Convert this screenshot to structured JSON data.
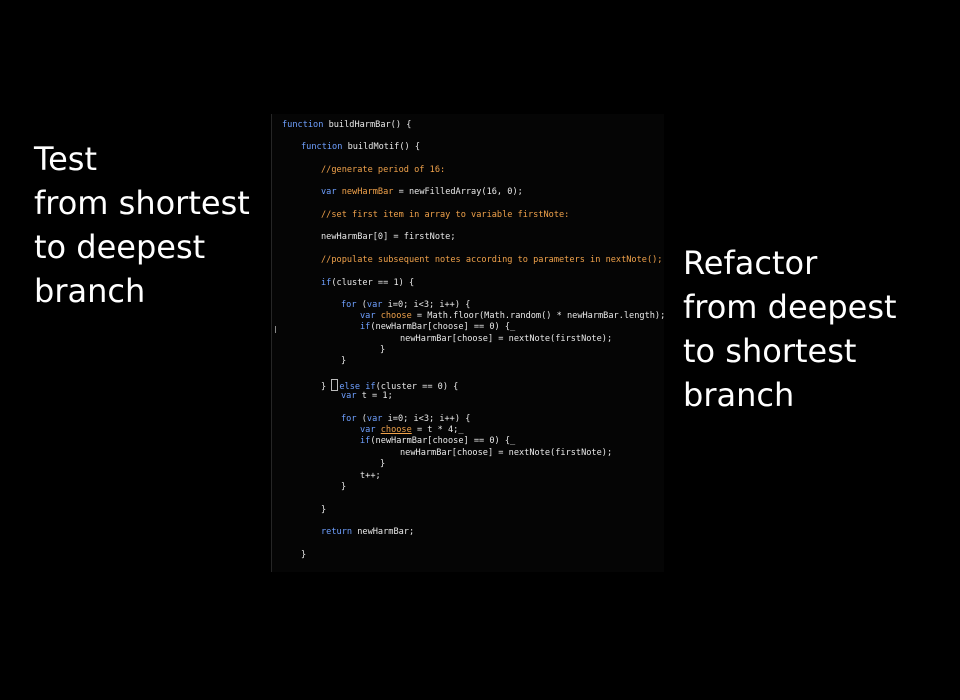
{
  "captions": {
    "left": [
      "Test",
      "from shortest",
      "to deepest",
      "branch"
    ],
    "right": [
      "Refactor",
      "from deepest",
      "to shortest",
      "branch"
    ]
  },
  "code": {
    "l1": {
      "kw": "function",
      "rest": " buildHarmBar() {"
    },
    "l2": {
      "kw": "function",
      "rest": " buildMotif() {"
    },
    "l3": "//generate period of 16:",
    "l4": {
      "kw": "var",
      "name": " newHarmBar",
      "rest": " = newFilledArray(16, 0);"
    },
    "l5": "//set first item in array to variable firstNote:",
    "l6": "newHarmBar[0] = firstNote;",
    "l7": "//populate subsequent notes according to parameters in nextNote();",
    "l8": {
      "kw": "if",
      "rest": "(cluster == 1) {"
    },
    "l9": {
      "kw": "for",
      "mid": " (",
      "kw2": "var",
      "rest": " i=0; i<3; i++) {"
    },
    "l10": {
      "kw": "var",
      "name": " choose",
      "rest": " = Math.floor(Math.random() * newHarmBar.length);"
    },
    "l11": {
      "kw": "if",
      "rest": "(newHarmBar[choose] == 0) {_"
    },
    "l12": "newHarmBar[choose] = nextNote(firstNote);",
    "l13": "}",
    "l14": "}",
    "l15": {
      "pre": "} ",
      "kw": "else if",
      "rest": "(cluster == 0) {"
    },
    "l16": {
      "kw": "var",
      "rest": " t = 1;"
    },
    "l17": {
      "kw": "for",
      "mid": " (",
      "kw2": "var",
      "rest": " i=0; i<3; i++) {"
    },
    "l18": {
      "kw": "var",
      "name": "choose",
      "rest": " = t * 4;_"
    },
    "l19": {
      "kw": "if",
      "rest": "(newHarmBar[choose] == 0) {_"
    },
    "l20": "newHarmBar[choose] = nextNote(firstNote);",
    "l21": "}",
    "l22": "t++;",
    "l23": "}",
    "l24": "}",
    "l25": {
      "kw": "return",
      "rest": " newHarmBar;"
    },
    "l26": "}"
  },
  "colors": {
    "background": "#000000",
    "caption": "#ffffff",
    "code_text": "#e9e9e9",
    "keyword": "#6fa0ff",
    "comment": "#f0a24b"
  }
}
